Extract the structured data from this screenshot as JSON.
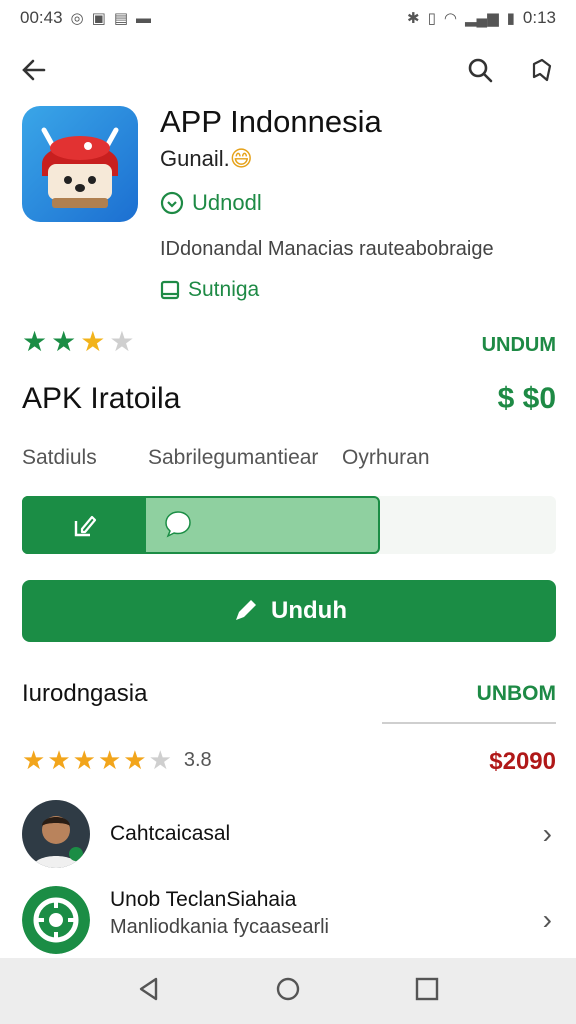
{
  "status_bar": {
    "time_left": "00:43",
    "time_right": "0:13"
  },
  "app": {
    "title": "APP Indonnesia",
    "developer": "Gunail.",
    "status": "Udnodl",
    "description": "IDdonandal Manacias rauteabobraige",
    "category": "Sutniga"
  },
  "rating": {
    "stars_value": 3,
    "stars_max": 4,
    "link": "UNDUM"
  },
  "apk": {
    "title": "APK Iratoila",
    "price": "$ $0"
  },
  "tabs": [
    "Satdiuls",
    "Sabrilegumantiear",
    "Oyrhuran"
  ],
  "progress": {
    "fraction": 0.67
  },
  "download": {
    "label": "Unduh"
  },
  "section": {
    "title": "Iurodngasia",
    "link": "UNBOM"
  },
  "review": {
    "stars_value": 5,
    "stars_max": 6,
    "score": "3.8",
    "price": "$2090"
  },
  "list": [
    {
      "title": "Cahtcaicasal"
    },
    {
      "title": "Unob TeclanSiahaia",
      "subtitle": "Manliodkania fycaasearli"
    }
  ],
  "colors": {
    "accent": "#1b8d45",
    "price_red": "#b01818",
    "star_gold": "#f2b31b",
    "star_grey": "#cfcfcf"
  }
}
